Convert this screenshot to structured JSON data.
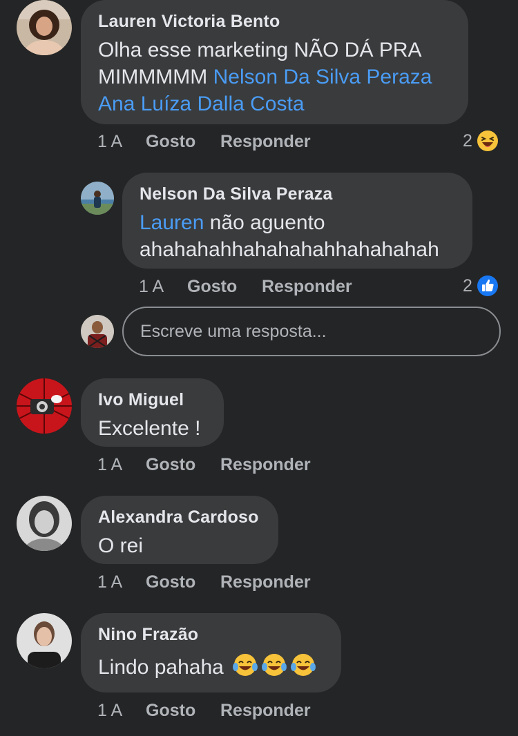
{
  "comments": [
    {
      "author": "Lauren Victoria Bento",
      "text_parts": [
        "Olha esse marketing NÃO DÁ PRA MIMMMMM "
      ],
      "mentions": [
        "Nelson Da Silva Peraza",
        "Ana Luíza Dalla Costa"
      ],
      "time": "1 A",
      "like_label": "Gosto",
      "reply_label": "Responder",
      "reaction_count": "2",
      "reaction_icon": "laughing-emoji-icon"
    },
    {
      "author": "Nelson Da Silva Peraza",
      "mention": "Lauren",
      "text": " não aguento ahahahahhahahahahhahahahah",
      "time": "1 A",
      "like_label": "Gosto",
      "reply_label": "Responder",
      "reaction_count": "2",
      "reaction_icon": "thumbs-up-icon"
    },
    {
      "author": "Ivo Miguel",
      "text": "Excelente !",
      "time": "1 A",
      "like_label": "Gosto",
      "reply_label": "Responder"
    },
    {
      "author": "Alexandra Cardoso",
      "text": "O rei",
      "time": "1 A",
      "like_label": "Gosto",
      "reply_label": "Responder"
    },
    {
      "author": "Nino Frazão",
      "text": "Lindo pahaha",
      "emojis": [
        "tears-of-joy-icon",
        "tears-of-joy-icon",
        "tears-of-joy-icon"
      ],
      "time": "1 A",
      "like_label": "Gosto",
      "reply_label": "Responder"
    }
  ],
  "reply_box": {
    "placeholder": "Escreve uma resposta..."
  },
  "colors": {
    "background": "#242526",
    "bubble": "#3a3b3c",
    "mention": "#4a9cf5",
    "meta": "#b0b3b8",
    "like_blue": "#1877f2"
  }
}
